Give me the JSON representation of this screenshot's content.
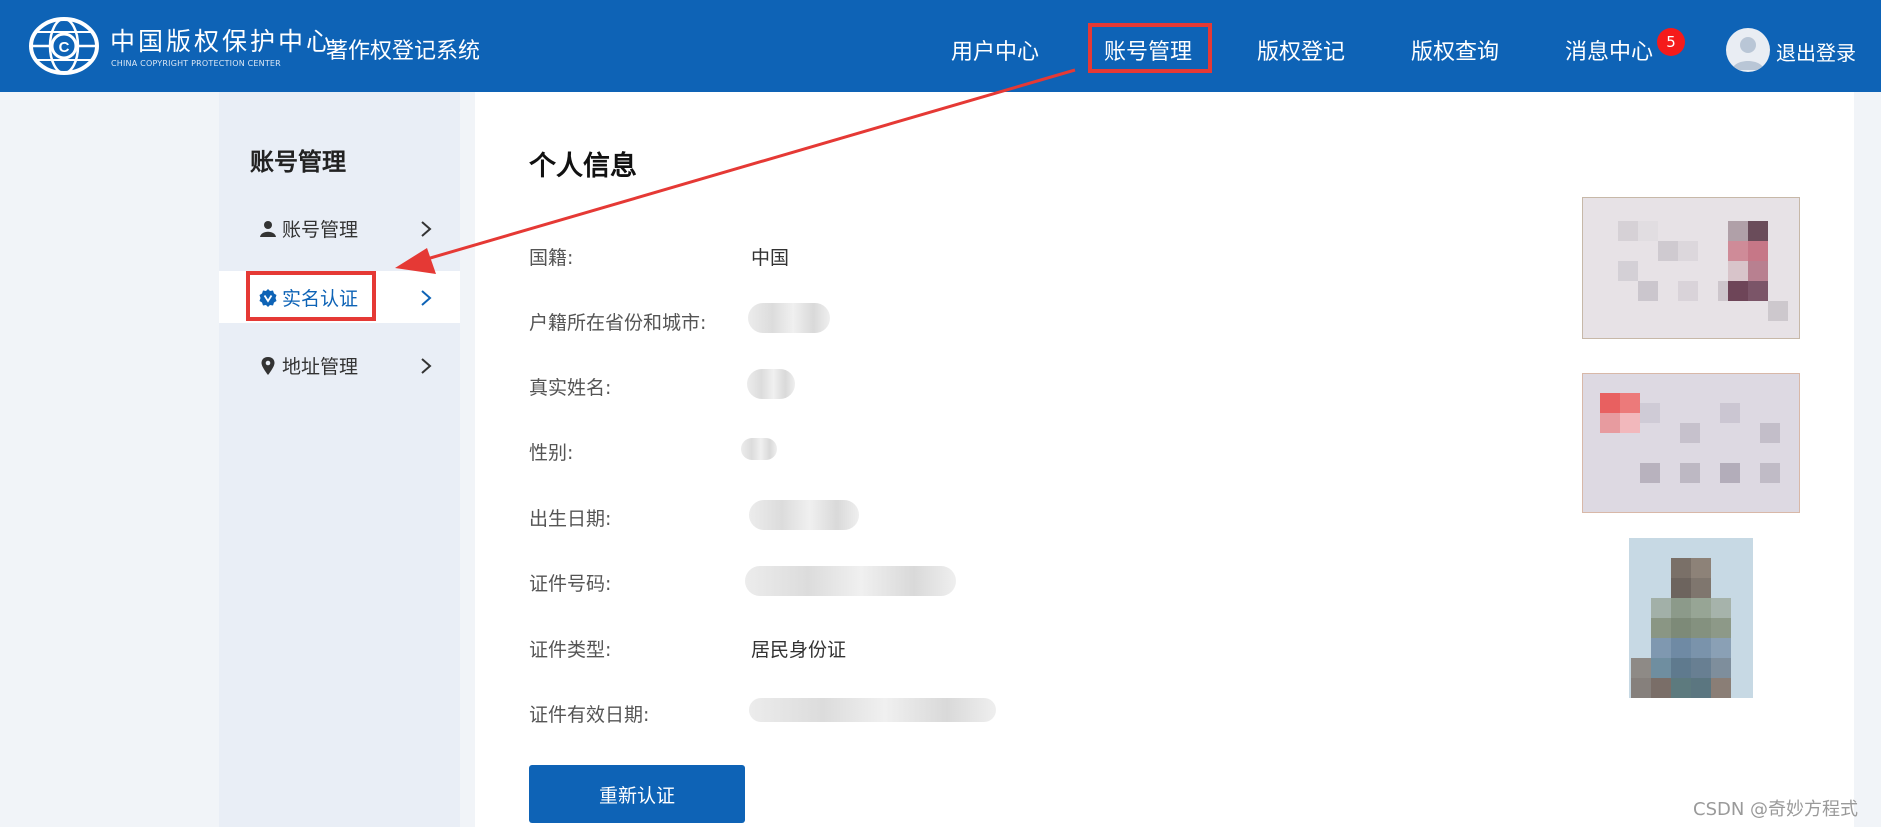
{
  "header": {
    "org_name_cn": "中国版权保护中心",
    "org_name_en": "CHINA COPYRIGHT PROTECTION CENTER",
    "system_name": "著作权登记系统",
    "nav": [
      {
        "label": "用户中心"
      },
      {
        "label": "账号管理",
        "active": true
      },
      {
        "label": "版权登记"
      },
      {
        "label": "版权查询"
      },
      {
        "label": "消息中心",
        "badge": "5"
      }
    ],
    "logout_label": "退出登录",
    "brand_color": "#0e63b6"
  },
  "sidebar": {
    "title": "账号管理",
    "items": [
      {
        "label": "账号管理",
        "icon": "user-icon"
      },
      {
        "label": "实名认证",
        "icon": "verified-badge-icon",
        "active": true
      },
      {
        "label": "地址管理",
        "icon": "location-pin-icon"
      }
    ]
  },
  "main": {
    "title": "个人信息",
    "fields": [
      {
        "label": "国籍:",
        "value": "中国"
      },
      {
        "label": "户籍所在省份和城市:",
        "value": ""
      },
      {
        "label": "真实姓名:",
        "value": ""
      },
      {
        "label": "性别:",
        "value": ""
      },
      {
        "label": "出生日期:",
        "value": ""
      },
      {
        "label": "证件号码:",
        "value": ""
      },
      {
        "label": "证件类型:",
        "value": "居民身份证"
      },
      {
        "label": "证件有效日期:",
        "value": ""
      }
    ],
    "reauth_button": "重新认证",
    "images": [
      "id-card-front-image",
      "id-card-back-image",
      "person-photo-image"
    ]
  },
  "annotation": {
    "highlight_color": "#e53935"
  },
  "watermark": "CSDN @奇妙方程式"
}
